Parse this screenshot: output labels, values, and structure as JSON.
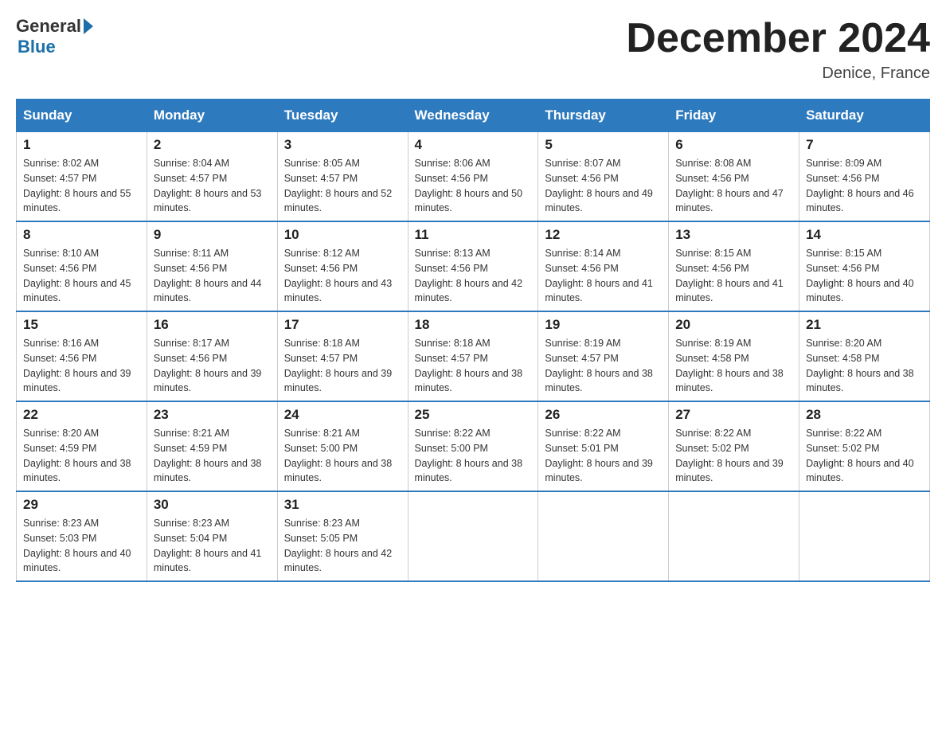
{
  "header": {
    "logo_general": "General",
    "logo_blue": "Blue",
    "month_title": "December 2024",
    "location": "Denice, France"
  },
  "days_of_week": [
    "Sunday",
    "Monday",
    "Tuesday",
    "Wednesday",
    "Thursday",
    "Friday",
    "Saturday"
  ],
  "weeks": [
    [
      {
        "day": "1",
        "sunrise": "8:02 AM",
        "sunset": "4:57 PM",
        "daylight": "8 hours and 55 minutes."
      },
      {
        "day": "2",
        "sunrise": "8:04 AM",
        "sunset": "4:57 PM",
        "daylight": "8 hours and 53 minutes."
      },
      {
        "day": "3",
        "sunrise": "8:05 AM",
        "sunset": "4:57 PM",
        "daylight": "8 hours and 52 minutes."
      },
      {
        "day": "4",
        "sunrise": "8:06 AM",
        "sunset": "4:56 PM",
        "daylight": "8 hours and 50 minutes."
      },
      {
        "day": "5",
        "sunrise": "8:07 AM",
        "sunset": "4:56 PM",
        "daylight": "8 hours and 49 minutes."
      },
      {
        "day": "6",
        "sunrise": "8:08 AM",
        "sunset": "4:56 PM",
        "daylight": "8 hours and 47 minutes."
      },
      {
        "day": "7",
        "sunrise": "8:09 AM",
        "sunset": "4:56 PM",
        "daylight": "8 hours and 46 minutes."
      }
    ],
    [
      {
        "day": "8",
        "sunrise": "8:10 AM",
        "sunset": "4:56 PM",
        "daylight": "8 hours and 45 minutes."
      },
      {
        "day": "9",
        "sunrise": "8:11 AM",
        "sunset": "4:56 PM",
        "daylight": "8 hours and 44 minutes."
      },
      {
        "day": "10",
        "sunrise": "8:12 AM",
        "sunset": "4:56 PM",
        "daylight": "8 hours and 43 minutes."
      },
      {
        "day": "11",
        "sunrise": "8:13 AM",
        "sunset": "4:56 PM",
        "daylight": "8 hours and 42 minutes."
      },
      {
        "day": "12",
        "sunrise": "8:14 AM",
        "sunset": "4:56 PM",
        "daylight": "8 hours and 41 minutes."
      },
      {
        "day": "13",
        "sunrise": "8:15 AM",
        "sunset": "4:56 PM",
        "daylight": "8 hours and 41 minutes."
      },
      {
        "day": "14",
        "sunrise": "8:15 AM",
        "sunset": "4:56 PM",
        "daylight": "8 hours and 40 minutes."
      }
    ],
    [
      {
        "day": "15",
        "sunrise": "8:16 AM",
        "sunset": "4:56 PM",
        "daylight": "8 hours and 39 minutes."
      },
      {
        "day": "16",
        "sunrise": "8:17 AM",
        "sunset": "4:56 PM",
        "daylight": "8 hours and 39 minutes."
      },
      {
        "day": "17",
        "sunrise": "8:18 AM",
        "sunset": "4:57 PM",
        "daylight": "8 hours and 39 minutes."
      },
      {
        "day": "18",
        "sunrise": "8:18 AM",
        "sunset": "4:57 PM",
        "daylight": "8 hours and 38 minutes."
      },
      {
        "day": "19",
        "sunrise": "8:19 AM",
        "sunset": "4:57 PM",
        "daylight": "8 hours and 38 minutes."
      },
      {
        "day": "20",
        "sunrise": "8:19 AM",
        "sunset": "4:58 PM",
        "daylight": "8 hours and 38 minutes."
      },
      {
        "day": "21",
        "sunrise": "8:20 AM",
        "sunset": "4:58 PM",
        "daylight": "8 hours and 38 minutes."
      }
    ],
    [
      {
        "day": "22",
        "sunrise": "8:20 AM",
        "sunset": "4:59 PM",
        "daylight": "8 hours and 38 minutes."
      },
      {
        "day": "23",
        "sunrise": "8:21 AM",
        "sunset": "4:59 PM",
        "daylight": "8 hours and 38 minutes."
      },
      {
        "day": "24",
        "sunrise": "8:21 AM",
        "sunset": "5:00 PM",
        "daylight": "8 hours and 38 minutes."
      },
      {
        "day": "25",
        "sunrise": "8:22 AM",
        "sunset": "5:00 PM",
        "daylight": "8 hours and 38 minutes."
      },
      {
        "day": "26",
        "sunrise": "8:22 AM",
        "sunset": "5:01 PM",
        "daylight": "8 hours and 39 minutes."
      },
      {
        "day": "27",
        "sunrise": "8:22 AM",
        "sunset": "5:02 PM",
        "daylight": "8 hours and 39 minutes."
      },
      {
        "day": "28",
        "sunrise": "8:22 AM",
        "sunset": "5:02 PM",
        "daylight": "8 hours and 40 minutes."
      }
    ],
    [
      {
        "day": "29",
        "sunrise": "8:23 AM",
        "sunset": "5:03 PM",
        "daylight": "8 hours and 40 minutes."
      },
      {
        "day": "30",
        "sunrise": "8:23 AM",
        "sunset": "5:04 PM",
        "daylight": "8 hours and 41 minutes."
      },
      {
        "day": "31",
        "sunrise": "8:23 AM",
        "sunset": "5:05 PM",
        "daylight": "8 hours and 42 minutes."
      },
      null,
      null,
      null,
      null
    ]
  ],
  "labels": {
    "sunrise": "Sunrise:",
    "sunset": "Sunset:",
    "daylight": "Daylight:"
  }
}
